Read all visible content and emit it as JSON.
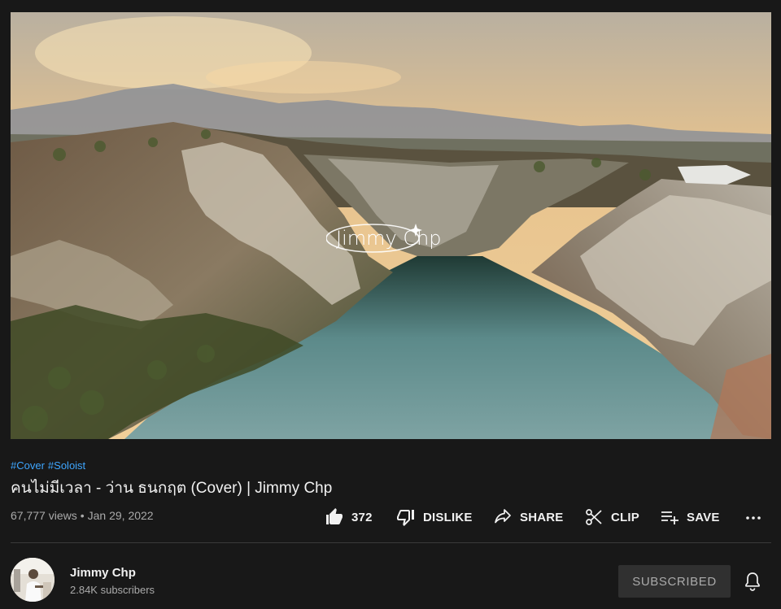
{
  "video": {
    "watermark_text": "Jimmy Chp",
    "hashtags": [
      "#Cover",
      "#Soloist"
    ],
    "title": "คนไม่มีเวลา - ว่าน ธนกฤต (Cover) | Jimmy Chp",
    "views": "67,777 views",
    "separator": "•",
    "date": "Jan 29, 2022"
  },
  "actions": {
    "like_count": "372",
    "dislike_label": "DISLIKE",
    "share_label": "SHARE",
    "clip_label": "CLIP",
    "save_label": "SAVE",
    "more_label": "..."
  },
  "channel": {
    "name": "Jimmy Chp",
    "subscribers": "2.84K subscribers",
    "subscribe_button": "SUBSCRIBED"
  },
  "icons": {
    "like": "thumbs-up-icon",
    "dislike": "thumbs-down-icon",
    "share": "share-arrow-icon",
    "clip": "scissors-icon",
    "save": "playlist-add-icon",
    "more": "more-dots-icon",
    "bell": "bell-icon"
  },
  "colors": {
    "background": "#181818",
    "hashtag": "#3ea6ff",
    "primary_text": "#f1f1f1",
    "secondary_text": "#aaaaaa",
    "subscribed_button_bg": "#303030"
  }
}
